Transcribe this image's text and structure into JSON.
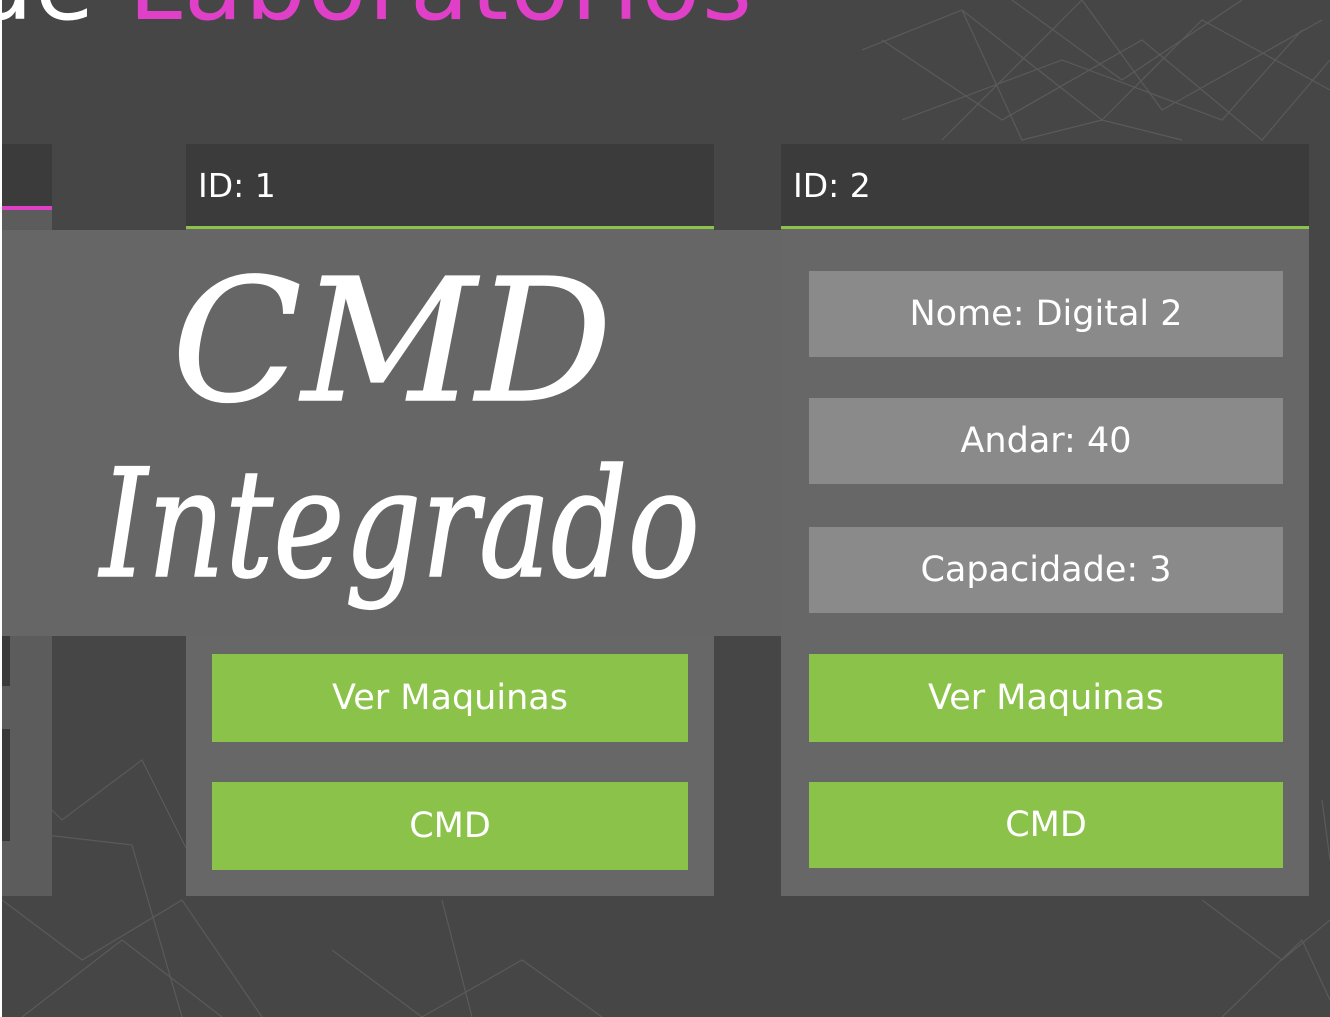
{
  "header": {
    "title_part1": "de",
    "title_part2": "Laboratorios"
  },
  "overlay": {
    "line1": "CMD",
    "line2": "Integrado"
  },
  "labs": [
    {
      "id_label": "ID: 1",
      "view_machines_label": "Ver Maquinas",
      "cmd_label": "CMD"
    },
    {
      "id_label": "ID: 2",
      "name_label": "Nome: Digital 2",
      "floor_label": "Andar: 40",
      "capacity_label": "Capacidade: 3",
      "view_machines_label": "Ver Maquinas",
      "cmd_label": "CMD"
    }
  ],
  "colors": {
    "background": "#464646",
    "card": "#676767",
    "card_header": "#3b3b3b",
    "accent_green": "#8bc34a",
    "accent_magenta": "#e040c8",
    "info_box": "#8a8a8a"
  }
}
